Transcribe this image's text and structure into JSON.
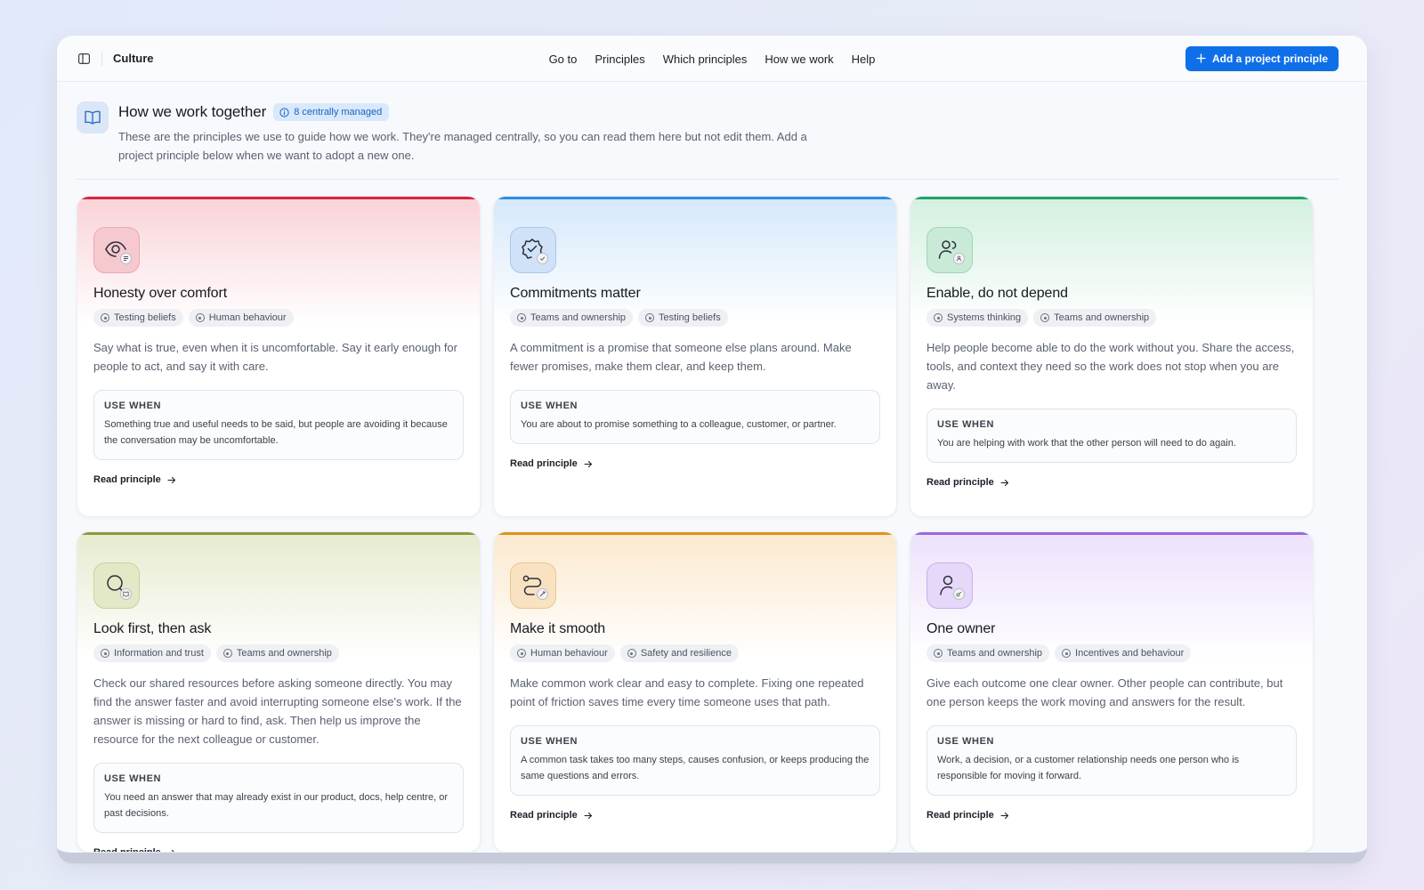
{
  "app": {
    "title": "Culture"
  },
  "nav": [
    "Go to",
    "Principles",
    "Which principles",
    "How we work",
    "Help"
  ],
  "actions": {
    "add_label": "Add a project principle"
  },
  "header": {
    "title": "How we work together",
    "badge": "8 centrally managed",
    "description": "These are the principles we use to guide how we work. They're managed centrally, so you can read them here but not edit them. Add a project principle below when we want to adopt a new one."
  },
  "colors": {
    "accent": "#0f6fe8",
    "red": "#d7263d",
    "blue": "#2f8ce6",
    "green": "#1fa466",
    "olive": "#8c9a3c",
    "orange": "#e0921a",
    "purple": "#9b66e0"
  },
  "use_when_label": "USE WHEN",
  "read_label": "Read principle",
  "cards": [
    {
      "title": "Honesty over comfort",
      "icon": "eye-message-icon",
      "tags": [
        "Testing beliefs",
        "Human behaviour"
      ],
      "description": "Say what is true, even when it is uncomfortable. Say it early enough for people to act, and say it with care.",
      "use_when": "Something true and useful needs to be said, but people are avoiding it because the conversation may be uncomfortable."
    },
    {
      "title": "Commitments matter",
      "icon": "badge-check-icon",
      "tags": [
        "Teams and ownership",
        "Testing beliefs"
      ],
      "description": "A commitment is a promise that someone else plans around. Make fewer promises, make them clear, and keep them.",
      "use_when": "You are about to promise something to a colleague, customer, or partner."
    },
    {
      "title": "Enable, do not depend",
      "icon": "users-icon",
      "tags": [
        "Systems thinking",
        "Teams and ownership"
      ],
      "description": "Help people become able to do the work without you. Share the access, tools, and context they need so the work does not stop when you are away.",
      "use_when": "You are helping with work that the other person will need to do again."
    },
    {
      "title": "Look first, then ask",
      "icon": "search-book-icon",
      "tags": [
        "Information and trust",
        "Teams and ownership"
      ],
      "description": "Check our shared resources before asking someone directly. You may find the answer faster and avoid interrupting someone else's work. If the answer is missing or hard to find, ask. Then help us improve the resource for the next colleague or customer.",
      "use_when": "You need an answer that may already exist in our product, docs, help centre, or past decisions."
    },
    {
      "title": "Make it smooth",
      "icon": "route-icon",
      "tags": [
        "Human behaviour",
        "Safety and resilience"
      ],
      "description": "Make common work clear and easy to complete. Fixing one repeated point of friction saves time every time someone uses that path.",
      "use_when": "A common task takes too many steps, causes confusion, or keeps producing the same questions and errors."
    },
    {
      "title": "One owner",
      "icon": "user-key-icon",
      "tags": [
        "Teams and ownership",
        "Incentives and behaviour"
      ],
      "description": "Give each outcome one clear owner. Other people can contribute, but one person keeps the work moving and answers for the result.",
      "use_when": "Work, a decision, or a customer relationship needs one person who is responsible for moving it forward."
    }
  ]
}
